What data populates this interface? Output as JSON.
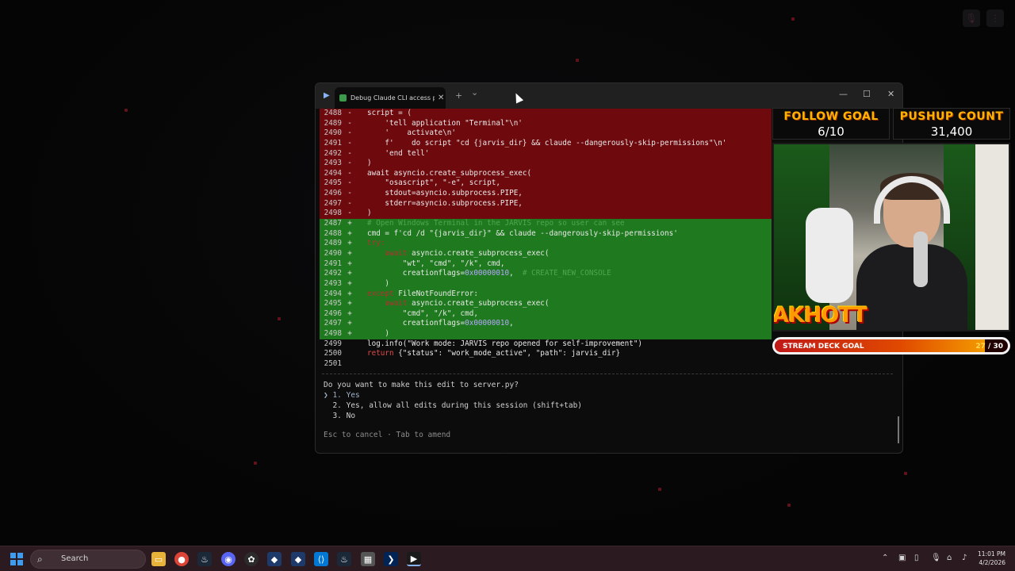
{
  "terminal": {
    "tab_title": "Debug Claude CLI access p",
    "new_tab": "+",
    "dropdown": "⌄",
    "minimize": "—",
    "maximize": "☐",
    "close": "✕",
    "diff_lines": [
      {
        "n": "2488",
        "s": "-",
        "type": "del",
        "t": "script = ("
      },
      {
        "n": "2489",
        "s": "-",
        "type": "del",
        "t": "    'tell application \"Terminal\"\\n'"
      },
      {
        "n": "2490",
        "s": "-",
        "type": "del",
        "t": "    '    activate\\n'"
      },
      {
        "n": "2491",
        "s": "-",
        "type": "del",
        "t": "    f'    do script \"cd {jarvis_dir} && claude --dangerously-skip-permissions\"\\n'"
      },
      {
        "n": "2492",
        "s": "-",
        "type": "del",
        "t": "    'end tell'"
      },
      {
        "n": "2493",
        "s": "-",
        "type": "del",
        "t": ")"
      },
      {
        "n": "2494",
        "s": "-",
        "type": "del",
        "t": "await asyncio.create_subprocess_exec("
      },
      {
        "n": "2495",
        "s": "-",
        "type": "del",
        "t": "    \"osascript\", \"-e\", script,"
      },
      {
        "n": "2496",
        "s": "-",
        "type": "del",
        "t": "    stdout=asyncio.subprocess.PIPE,"
      },
      {
        "n": "2497",
        "s": "-",
        "type": "del",
        "t": "    stderr=asyncio.subprocess.PIPE,"
      },
      {
        "n": "2498",
        "s": "-",
        "type": "del",
        "t": ")"
      },
      {
        "n": "2487",
        "s": "+",
        "type": "add",
        "t": "# Open Windows Terminal in the JARVIS repo so user can see",
        "cls": "cm"
      },
      {
        "n": "2488",
        "s": "+",
        "type": "add",
        "t": "cmd = f'cd /d \"{jarvis_dir}\" && claude --dangerously-skip-permissions'"
      },
      {
        "n": "2489",
        "s": "+",
        "type": "add",
        "t": "try:",
        "cls": "kw"
      },
      {
        "n": "2490",
        "s": "+",
        "type": "add",
        "pre": "    ",
        "kw": "await",
        "t": " asyncio.create_subprocess_exec("
      },
      {
        "n": "2491",
        "s": "+",
        "type": "add",
        "t": "        \"wt\", \"cmd\", \"/k\", cmd,"
      },
      {
        "n": "2492",
        "s": "+",
        "type": "add",
        "t": "        creationflags=",
        "num": "0x00000010",
        "post": ",  ",
        "cm": "# CREATE_NEW_CONSOLE"
      },
      {
        "n": "2493",
        "s": "+",
        "type": "add",
        "t": "    )"
      },
      {
        "n": "2494",
        "s": "+",
        "type": "add",
        "kw": "except",
        "t": " FileNotFoundError:"
      },
      {
        "n": "2495",
        "s": "+",
        "type": "add",
        "pre": "    ",
        "kw": "await",
        "t": " asyncio.create_subprocess_exec("
      },
      {
        "n": "2496",
        "s": "+",
        "type": "add",
        "t": "        \"cmd\", \"/k\", cmd,"
      },
      {
        "n": "2497",
        "s": "+",
        "type": "add",
        "t": "        creationflags=",
        "num": "0x00000010",
        "post": ","
      },
      {
        "n": "2498",
        "s": "+",
        "type": "add",
        "t": "    )"
      },
      {
        "n": "2499",
        "s": "",
        "type": "ctx",
        "t": "log.info(\"Work mode: JARVIS repo opened for self-improvement\")"
      },
      {
        "n": "2500",
        "s": "",
        "type": "ctx",
        "kw": "return",
        "t": " {\"status\": \"work_mode_active\", \"path\": jarvis_dir}"
      },
      {
        "n": "2501",
        "s": "",
        "type": "ctx",
        "t": ""
      }
    ],
    "question": "Do you want to make this edit to server.py?",
    "options": [
      "❯ 1. Yes",
      "  2. Yes, allow all edits during this session (shift+tab)",
      "  3. No"
    ],
    "hint": "Esc to cancel · Tab to amend"
  },
  "overlay": {
    "follow_label": "FOLLOW GOAL",
    "follow_value": "6/10",
    "pushup_label": "PUSHUP COUNT",
    "pushup_value": "31,400",
    "name_text": "AKHOTT",
    "deck_label": "STREAM DECK GOAL",
    "deck_current": "27",
    "deck_sep": " / ",
    "deck_target": "30",
    "deck_progress": 0.9
  },
  "taskbar": {
    "search_placeholder": "Search",
    "time": "11:01 PM",
    "date": "4/2/2026"
  },
  "colors": {
    "deleted_bg": "#6e0a0e",
    "added_bg": "#1f7a1f",
    "accent_orange": "#ffb300",
    "taskbar_bg": "#2b1a20"
  }
}
